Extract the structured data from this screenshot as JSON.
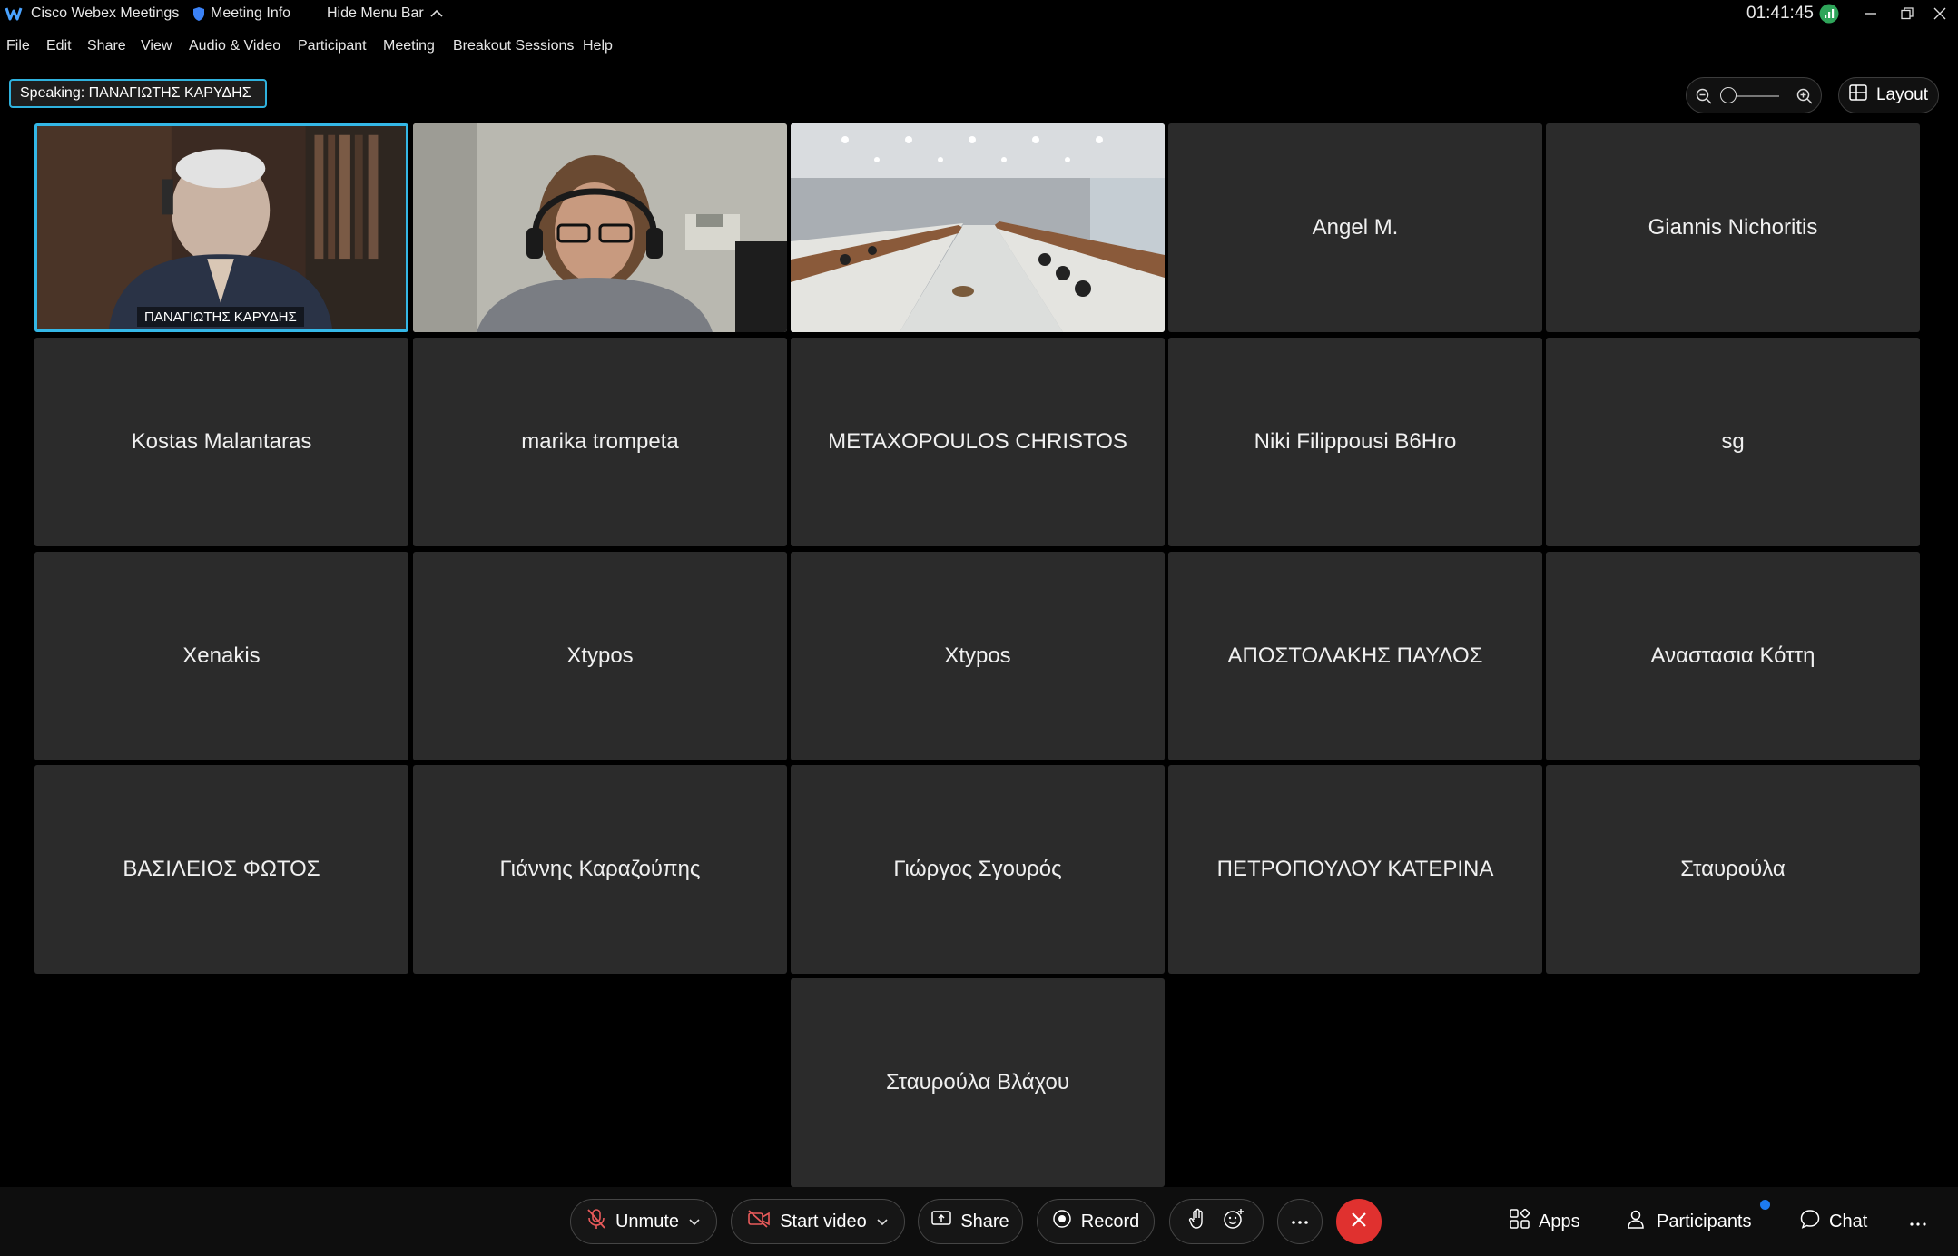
{
  "titlebar": {
    "app_title": "Cisco Webex Meetings",
    "meeting_info": "Meeting Info",
    "hide_menu_bar": "Hide Menu Bar",
    "clock": "01:41:45"
  },
  "menu": [
    "File",
    "Edit",
    "Share",
    "View",
    "Audio & Video",
    "Participant",
    "Meeting",
    "Breakout Sessions",
    "Help"
  ],
  "speaking": {
    "label": "Speaking:",
    "name": "ΠΑΝΑΓΙΩΤΗΣ ΚΑΡΥΔΗΣ"
  },
  "layout_label": "Layout",
  "participants": [
    {
      "name": "ΠΑΝΑΓΙΩΤΗΣ ΚΑΡΥΔΗΣ",
      "video": true,
      "active_speaker": true
    },
    {
      "name": "",
      "video": true
    },
    {
      "name": "",
      "video": true
    },
    {
      "name": "Angel M."
    },
    {
      "name": "Giannis Nichoritis"
    },
    {
      "name": "Kostas Malantaras"
    },
    {
      "name": "marika trompeta"
    },
    {
      "name": "METAXOPOULOS CHRISTOS"
    },
    {
      "name": "Niki Filippousi B6Hro"
    },
    {
      "name": "sg"
    },
    {
      "name": "Xenakis"
    },
    {
      "name": "Xtypos"
    },
    {
      "name": "Xtypos"
    },
    {
      "name": "ΑΠΟΣΤΟΛΑΚΗΣ ΠΑΥΛΟΣ"
    },
    {
      "name": "Αναστασια Κόττη"
    },
    {
      "name": "ΒΑΣΙΛΕΙΟΣ ΦΩΤΟΣ"
    },
    {
      "name": "Γιάννης Καραζούπης"
    },
    {
      "name": "Γιώργος Σγουρός"
    },
    {
      "name": "ΠΕΤΡΟΠΟΥΛΟΥ ΚΑΤΕΡΙΝΑ"
    },
    {
      "name": "Σταυρούλα"
    },
    {
      "name": "Σταυρούλα Βλάχου"
    }
  ],
  "controls": {
    "unmute": "Unmute",
    "start_video": "Start video",
    "share": "Share",
    "record": "Record",
    "apps": "Apps",
    "participants": "Participants",
    "chat": "Chat"
  },
  "colors": {
    "accent": "#34b7e6",
    "end_call": "#e0312f",
    "mute_red": "#e85a5a",
    "notification_dot": "#1d7bf0"
  }
}
